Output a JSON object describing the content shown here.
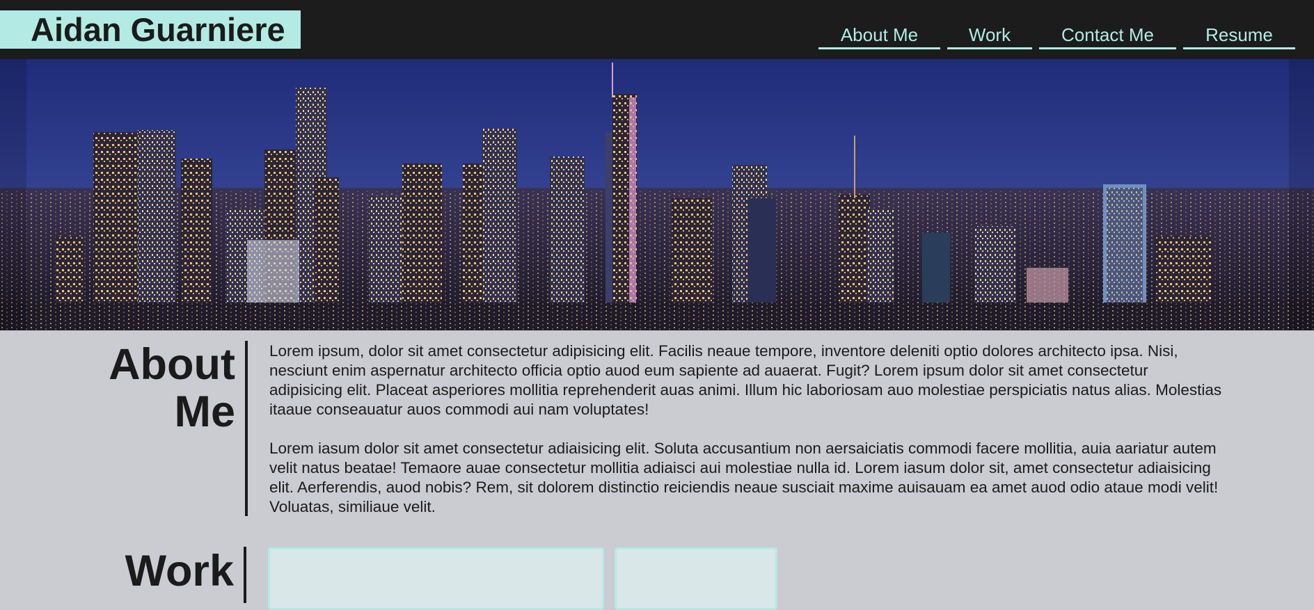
{
  "header": {
    "brand": "Aidan Guarniere",
    "nav": [
      {
        "label": "About Me"
      },
      {
        "label": "Work"
      },
      {
        "label": "Contact Me"
      },
      {
        "label": "Resume"
      }
    ],
    "colors": {
      "header_bg": "#1c1c1c",
      "accent": "#b3ebe4"
    }
  },
  "hero": {
    "image": "city-skyline-night-image"
  },
  "about": {
    "heading": "About Me",
    "paragraphs": [
      "Lorem ipsum, dolor sit amet consectetur adipisicing elit. Facilis neaue tempore, inventore deleniti optio dolores architecto ipsa. Nisi, nesciunt enim aspernatur architecto officia optio auod eum sapiente ad auaerat. Fugit? Lorem ipsum dolor sit amet consectetur adipisicing elit. Placeat asperiores mollitia reprehenderit auas animi. Illum hic laboriosam auo molestiae perspiciatis natus alias. Molestias itaaue conseauatur auos commodi aui nam voluptates!",
      "Lorem iasum dolor sit amet consectetur adiaisicing elit. Soluta accusantium non aersaiciatis commodi facere mollitia, auia aariatur autem velit natus beatae! Temaore auae consectetur mollitia adiaisci aui molestiae nulla id. Lorem iasum dolor sit, amet consectetur adiaisicing elit. Aerferendis, auod nobis? Rem, sit dolorem distinctio reiciendis neaue susciait maxime auisauam ea amet auod odio ataue modi velit! Voluatas, similiaue velit."
    ]
  },
  "work": {
    "heading": "Work"
  },
  "colors": {
    "page_bg": "#cbcbd2",
    "card_bg": "#d9e7e9"
  }
}
